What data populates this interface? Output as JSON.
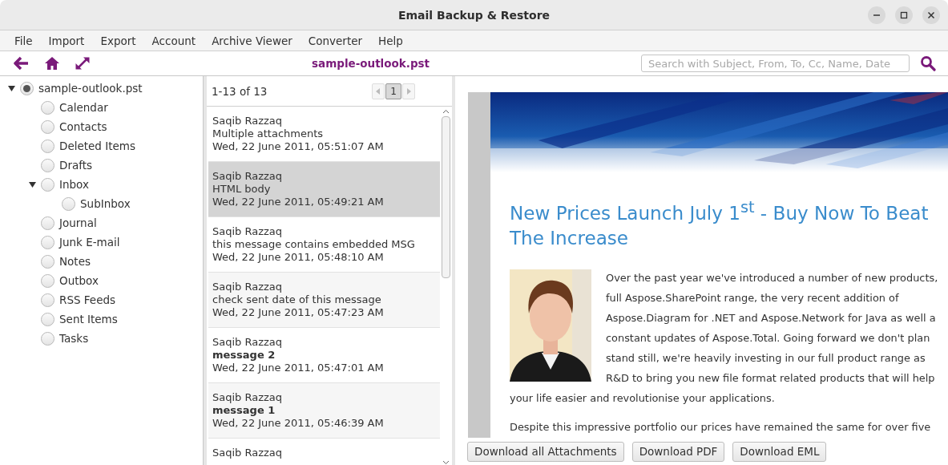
{
  "window": {
    "title": "Email Backup & Restore"
  },
  "menu": [
    "File",
    "Import",
    "Export",
    "Account",
    "Archive Viewer",
    "Converter",
    "Help"
  ],
  "toolbar": {
    "file_name": "sample-outlook.pst",
    "search": {
      "placeholder": "Search with Subject, From, To, Cc, Name, Date"
    }
  },
  "folders": [
    {
      "label": "sample-outlook.pst",
      "selected": true,
      "expanded": true,
      "children": [
        {
          "label": "Calendar",
          "selected": false
        },
        {
          "label": "Contacts",
          "selected": false
        },
        {
          "label": "Deleted Items",
          "selected": false
        },
        {
          "label": "Drafts",
          "selected": false
        },
        {
          "label": "Inbox",
          "selected": false,
          "expanded": true,
          "children": [
            {
              "label": "SubInbox",
              "selected": false
            }
          ]
        },
        {
          "label": "Journal",
          "selected": false
        },
        {
          "label": "Junk E-mail",
          "selected": false
        },
        {
          "label": "Notes",
          "selected": false
        },
        {
          "label": "Outbox",
          "selected": false
        },
        {
          "label": "RSS Feeds",
          "selected": false
        },
        {
          "label": "Sent Items",
          "selected": false
        },
        {
          "label": "Tasks",
          "selected": false
        }
      ]
    }
  ],
  "messages": {
    "range": "1-13 of 13",
    "pages": [
      {
        "label": "1",
        "selected": true
      }
    ],
    "items": [
      {
        "sender": "Saqib Razzaq",
        "subject": "Multiple attachments",
        "date": "Wed, 22 June 2011, 05:51:07 AM",
        "selected": false,
        "unread": false
      },
      {
        "sender": "Saqib Razzaq",
        "subject": "HTML body",
        "date": "Wed, 22 June 2011, 05:49:21 AM",
        "selected": true,
        "unread": false
      },
      {
        "sender": "Saqib Razzaq",
        "subject": "this message contains embedded MSG",
        "date": "Wed, 22 June 2011, 05:48:10 AM",
        "selected": false,
        "unread": false
      },
      {
        "sender": "Saqib Razzaq",
        "subject": "check sent date of this message",
        "date": "Wed, 22 June 2011, 05:47:23 AM",
        "selected": false,
        "unread": false
      },
      {
        "sender": "Saqib Razzaq",
        "subject": "message 2",
        "date": "Wed, 22 June 2011, 05:47:01 AM",
        "selected": false,
        "unread": true
      },
      {
        "sender": "Saqib Razzaq",
        "subject": "message 1",
        "date": "Wed, 22 June 2011, 05:46:39 AM",
        "selected": false,
        "unread": true
      },
      {
        "sender": "Saqib Razzaq"
      }
    ]
  },
  "email": {
    "heading_lines": [
      "New Prices Launch July 1$^{st}$ - Buy Now To Beat",
      "The Increase"
    ],
    "paragraph_lines": [
      "Over the past year we've introduced a number of new products,",
      "full Aspose.SharePoint range, the very recent addition of",
      "Aspose.Diagram for .NET and Aspose.Network for Java as well a",
      "constant updates of Aspose.Total. Going forward we don't plan",
      "stand still, we're heavily investing in our full product range as",
      "R&D to bring you new file format related products that will help",
      "your life easier and revolutionise your applications."
    ],
    "second_paragraph": "Despite this impressive portfolio our prices have remained the same for over five",
    "buttons": [
      "Download all Attachments",
      "Download PDF",
      "Download EML"
    ]
  }
}
